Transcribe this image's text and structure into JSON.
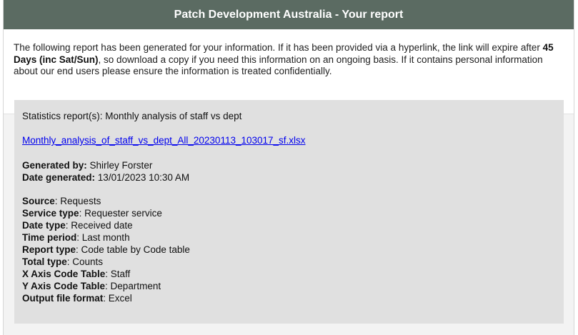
{
  "header": {
    "title": "Patch Development Australia - Your report"
  },
  "notice": {
    "text_before": "The following report has been generated for your information. If it has been provided via a hyperlink, the link will expire after ",
    "expiry": "45 Days (inc Sat/Sun)",
    "text_after": ", so download a copy if you need this information on an ongoing basis. If it contains personal information about our end users please ensure the information is treated confidentially."
  },
  "report": {
    "stats_title": "Statistics report(s): Monthly analysis of staff vs dept",
    "file_link": "Monthly_analysis_of_staff_vs_dept_All_20230113_103017_sf.xlsx",
    "generated_by_label": "Generated by:",
    "generated_by": "Shirley Forster",
    "date_generated_label": "Date generated:",
    "date_generated": "13/01/2023 10:30 AM",
    "details": [
      {
        "label": "Source",
        "value": ": Requests"
      },
      {
        "label": "Service type",
        "value": ": Requester service"
      },
      {
        "label": "Date type",
        "value": ": Received date"
      },
      {
        "label": "Time period",
        "value": ": Last month"
      },
      {
        "label": "Report type",
        "value": ": Code table by Code table"
      },
      {
        "label": "Total type",
        "value": ": Counts"
      },
      {
        "label": "X Axis Code Table",
        "value": ": Staff"
      },
      {
        "label": "Y Axis Code Table",
        "value": ": Department"
      },
      {
        "label": "Output file format",
        "value": ": Excel"
      }
    ]
  },
  "colors": {
    "header_bg": "#5b6b62",
    "panel_bg": "#e0e0e0",
    "link": "#0000ee"
  }
}
